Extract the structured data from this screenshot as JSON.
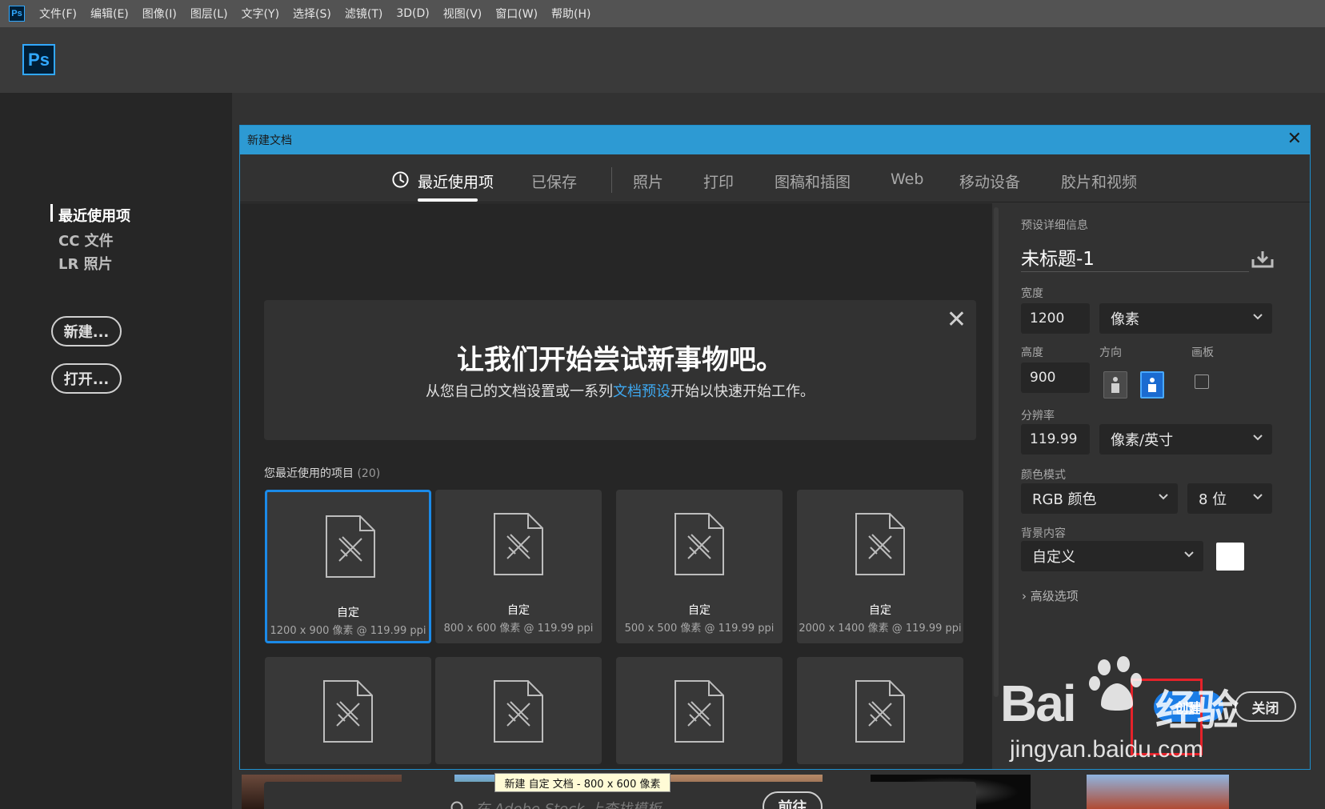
{
  "app": {
    "logo_text": "Ps",
    "home_logo_text": "Ps"
  },
  "menu": [
    "文件(F)",
    "编辑(E)",
    "图像(I)",
    "图层(L)",
    "文字(Y)",
    "选择(S)",
    "滤镜(T)",
    "3D(D)",
    "视图(V)",
    "窗口(W)",
    "帮助(H)"
  ],
  "home": {
    "nav": [
      "最近使用项",
      "CC 文件",
      "LR 照片"
    ],
    "new_button": "新建...",
    "open_button": "打开..."
  },
  "dialog": {
    "title": "新建文档",
    "tabs": [
      "最近使用项",
      "已保存",
      "照片",
      "打印",
      "图稿和插图",
      "Web",
      "移动设备",
      "胶片和视频"
    ],
    "active_tab": "最近使用项",
    "welcome": {
      "title": "让我们开始尝试新事物吧。",
      "sub_before": "从您自己的文档设置或一系列",
      "sub_link": "文档预设",
      "sub_after": "开始以快速开始工作。"
    },
    "recent_label": "您最近使用的项目",
    "recent_count": "(20)",
    "recent_items": [
      {
        "name": "自定",
        "spec": "1200 x 900 像素 @ 119.99 ppi",
        "selected": true
      },
      {
        "name": "自定",
        "spec": "800 x 600 像素 @ 119.99 ppi",
        "selected": false
      },
      {
        "name": "自定",
        "spec": "500 x 500 像素 @ 119.99 ppi",
        "selected": false
      },
      {
        "name": "自定",
        "spec": "2000 x 1400 像素 @ 119.99 ppi",
        "selected": false
      }
    ],
    "tooltip": "新建 自定 文档 - 800 x 600 像素",
    "stock": {
      "placeholder": "在 Adobe Stock 上查找模板",
      "go_button": "前往"
    },
    "preset": {
      "section_label": "预设详细信息",
      "name": "未标题-1",
      "width_label": "宽度",
      "width_value": "1200",
      "width_unit": "像素",
      "height_label": "高度",
      "height_value": "900",
      "orientation_label": "方向",
      "orientation": "landscape",
      "artboard_label": "画板",
      "artboard_checked": false,
      "resolution_label": "分辨率",
      "resolution_value": "119.99",
      "resolution_unit": "像素/英寸",
      "color_mode_label": "颜色模式",
      "color_mode": "RGB 颜色",
      "bit_depth": "8 位",
      "background_label": "背景内容",
      "background": "自定义",
      "background_color": "#ffffff",
      "advanced": "高级选项",
      "create_button": "创建",
      "close_button": "关闭"
    }
  },
  "watermark": {
    "brand": "Bai",
    "text": "经验",
    "url": "jingyan.baidu.com"
  },
  "colors": {
    "accent": "#1b7de6",
    "title_bar": "#2d9ad3",
    "highlight_box": "#e5222a"
  }
}
